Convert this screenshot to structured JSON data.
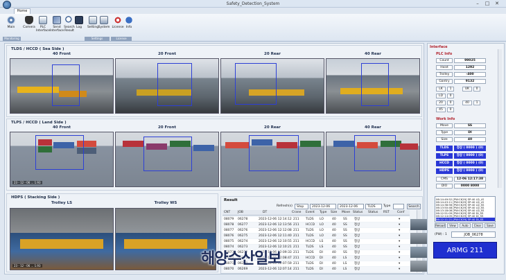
{
  "window": {
    "title": "Safety_Detection_System"
  },
  "ribbon": {
    "tab": "Home",
    "buttons": [
      "Main",
      "Camera",
      "PLC Interface",
      "Send Interface",
      "Search Result",
      "Log",
      "Setting",
      "System",
      "License",
      "Info"
    ],
    "groups": [
      "Monitoring",
      "Settings",
      "License"
    ]
  },
  "sections": {
    "tlds": "TLDS / HCCD ( Sea Side )",
    "tlps": "TLPS / HCCD ( Land Side )",
    "hdps": "HDPS ( Stacking Side )"
  },
  "cameras": {
    "sea": [
      "40 Front",
      "20 Front",
      "20 Rear",
      "40 Rear"
    ],
    "land": [
      "40 Front",
      "20 Front",
      "20 Rear",
      "40 Rear"
    ],
    "stack": [
      "Trolley LS",
      "Trolley WS"
    ],
    "stamp": "23 - 12 - 06 ... 1.93"
  },
  "result": {
    "title": "Result",
    "refresh_label": "Refresh(s)",
    "stop": "Stop",
    "date_from": "2023-12-06",
    "date_to": "2023-12-06",
    "system": "TLDS",
    "type_label": "Type",
    "search": "Search",
    "columns": [
      "CNT",
      "JOB",
      "DT",
      "Crane",
      "Event",
      "Type",
      "Size",
      "Move",
      "Status",
      "Status",
      "RST",
      "Conf"
    ],
    "rows": [
      [
        "08079",
        "06278",
        "2023-12-06 12:14:12",
        "211",
        "TLDS",
        "LO",
        "40",
        "SS",
        "정상",
        ""
      ],
      [
        "08078",
        "06277",
        "2023-12-06 12:13:56",
        "211",
        "HCCD",
        "LO",
        "40",
        "SS",
        "정상",
        ""
      ],
      [
        "08077",
        "06276",
        "2023-12-06 12:12:08",
        "211",
        "TLDS",
        "LO",
        "40",
        "SS",
        "정상",
        ""
      ],
      [
        "08076",
        "06275",
        "2023-12-06 12:11:40",
        "211",
        "TLDS",
        "LO",
        "40",
        "SS",
        "정상",
        ""
      ],
      [
        "08075",
        "06274",
        "2023-12-06 12:10:55",
        "211",
        "HCCD",
        "LS",
        "40",
        "SS",
        "정상",
        ""
      ],
      [
        "08074",
        "06273",
        "2023-12-06 12:10:21",
        "211",
        "TLDS",
        "LS",
        "40",
        "SS",
        "정상",
        ""
      ],
      [
        "08073",
        "06272",
        "2023-12-06 12:09:33",
        "211",
        "TLDS",
        "DI",
        "40",
        "SS",
        "정상",
        ""
      ],
      [
        "08072",
        "06271",
        "2023-12-06 12:08:47",
        "211",
        "HCCD",
        "DI",
        "40",
        "LS",
        "정상",
        ""
      ],
      [
        "08071",
        "06270",
        "2023-12-06 12:07:59",
        "211",
        "TLDS",
        "DI",
        "40",
        "LS",
        "정상",
        ""
      ],
      [
        "08070",
        "06269",
        "2023-12-06 12:07:14",
        "211",
        "TLDS",
        "DI",
        "40",
        "LS",
        "정상",
        ""
      ]
    ]
  },
  "interface": {
    "title": "Interface",
    "plc_title": "PLC Info",
    "plc": [
      {
        "k": "Count",
        "v": "99025"
      },
      {
        "k": "Hoist",
        "v": "1292"
      },
      {
        "k": "Trolley",
        "v": "-400"
      },
      {
        "k": "Gantry",
        "v": "9132"
      }
    ],
    "flags": [
      [
        "LK",
        "1",
        "UK",
        "0"
      ],
      [
        "LD",
        "0",
        "",
        ""
      ],
      [
        "20",
        "0",
        "40",
        "1"
      ],
      [
        "45",
        "0",
        "",
        ""
      ]
    ],
    "work_title": "Work Info",
    "work": [
      {
        "k": "Move",
        "v": "SS"
      },
      {
        "k": "Type",
        "v": "DI"
      },
      {
        "k": "Size",
        "v": "40"
      }
    ],
    "status": [
      {
        "k": "TLDS",
        "v": "정상 ( 0000 ) (0)"
      },
      {
        "k": "TLPS",
        "v": "정상 ( 0000 ) (0)"
      },
      {
        "k": "HCCD",
        "v": "정상 ( 0000 ) (0)"
      },
      {
        "k": "HDPS",
        "v": "정상 ( 0000 ) (0)"
      }
    ],
    "cms": {
      "k": "CMS",
      "v": "12-06 12:17:38"
    },
    "dio": {
      "k": "DIO",
      "v": "0000 8000"
    },
    "log": [
      "06:14:49:52 [PW:CK29] SP:40 LD_LS",
      "06:14:43:11 [PW:CK29] SP:40 LD_LS",
      "06:14:38:56 [PW:CK29] SP:40 LD_SS",
      "06:13:50:48 [PW:CK29] SP:40 LD_SS",
      "06:13:18:08 [PW:CK29] SP:40 LD_SS",
      "06:12:51:09 [PW:CK29] SP:40 DI_SS",
      "06:12:14:05 [PW:CK29] SP:40 DI_SS",
      "06:12:11:21 [PW:CK29] SP:40 DI_SS"
    ],
    "log_buttons": [
      "Reload",
      "View",
      "Auto",
      "Clear",
      "Save"
    ],
    "pw": "(PW) : 1",
    "job": "JOB_06278",
    "crane": "ARMG 211"
  },
  "watermark": "해양수산일보"
}
